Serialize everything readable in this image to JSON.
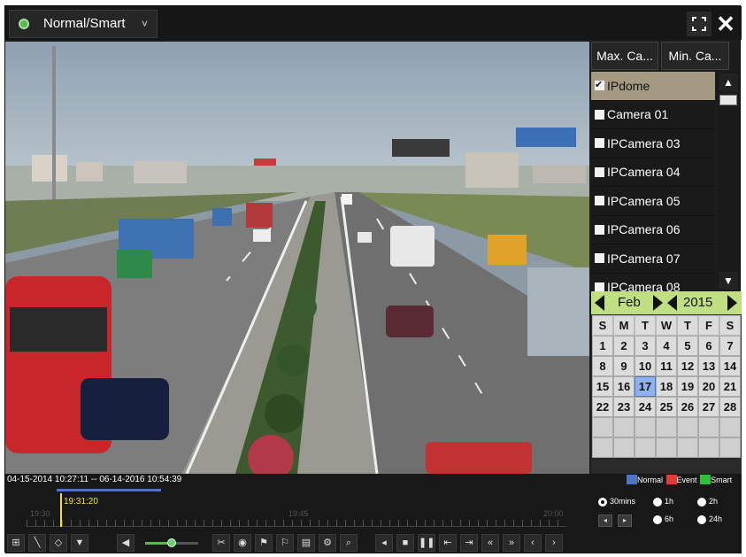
{
  "header": {
    "mode_label": "Normal/Smart",
    "caret": "˅",
    "close_glyph": "✕"
  },
  "camera_tabs": {
    "max": "Max. Ca...",
    "min": "Min. Ca..."
  },
  "cameras": [
    {
      "label": "IPdome",
      "checked": true,
      "selected": true
    },
    {
      "label": "Camera 01",
      "checked": false,
      "selected": false
    },
    {
      "label": "IPCamera 03",
      "checked": false,
      "selected": false
    },
    {
      "label": "IPCamera 04",
      "checked": false,
      "selected": false
    },
    {
      "label": "IPCamera 05",
      "checked": false,
      "selected": false
    },
    {
      "label": "IPCamera 06",
      "checked": false,
      "selected": false
    },
    {
      "label": "IPCamera 07",
      "checked": false,
      "selected": false
    },
    {
      "label": "IPCamera 08",
      "checked": false,
      "selected": false
    }
  ],
  "calendar": {
    "month": "Feb",
    "year": "2015",
    "days_of_week": [
      "S",
      "M",
      "T",
      "W",
      "T",
      "F",
      "S"
    ],
    "days": [
      "1",
      "2",
      "3",
      "4",
      "5",
      "6",
      "7",
      "8",
      "9",
      "10",
      "11",
      "12",
      "13",
      "14",
      "15",
      "16",
      "17",
      "18",
      "19",
      "20",
      "21",
      "22",
      "23",
      "24",
      "25",
      "26",
      "27",
      "28"
    ],
    "today": "17",
    "trailing_empty_cells": 14
  },
  "playback": {
    "range_text": "04-15-2014 10:27:11 -- 06-14-2016 10:54:39",
    "cursor_time": "19:31:20",
    "tick_labels": [
      "19:30",
      "19:45",
      "20:00"
    ],
    "legend": [
      {
        "label": "Normal",
        "color": "#4f74c6"
      },
      {
        "label": "Event",
        "color": "#e03a3a"
      },
      {
        "label": "Smart",
        "color": "#2fbf3a"
      }
    ],
    "zoom_options": [
      {
        "label": "30mins",
        "selected": true
      },
      {
        "label": "1h",
        "selected": false
      },
      {
        "label": "2h",
        "selected": false
      },
      {
        "label": "6h",
        "selected": false
      },
      {
        "label": "24h",
        "selected": false
      }
    ],
    "volume_level": 0.5
  },
  "toolbar_icons": [
    "layout-icon",
    "draw-line-icon",
    "ptz-icon",
    "filter-icon",
    "audio-icon",
    "clip-icon",
    "snapshot-icon",
    "tag-icon",
    "custom-tag-icon",
    "lock-file-icon",
    "settings-icon",
    "digital-zoom-icon",
    "reverse-play-icon",
    "stop-icon",
    "pause-icon",
    "step-back-icon",
    "step-forward-icon",
    "slow-icon",
    "fast-icon",
    "previous-day-icon",
    "next-day-icon"
  ]
}
